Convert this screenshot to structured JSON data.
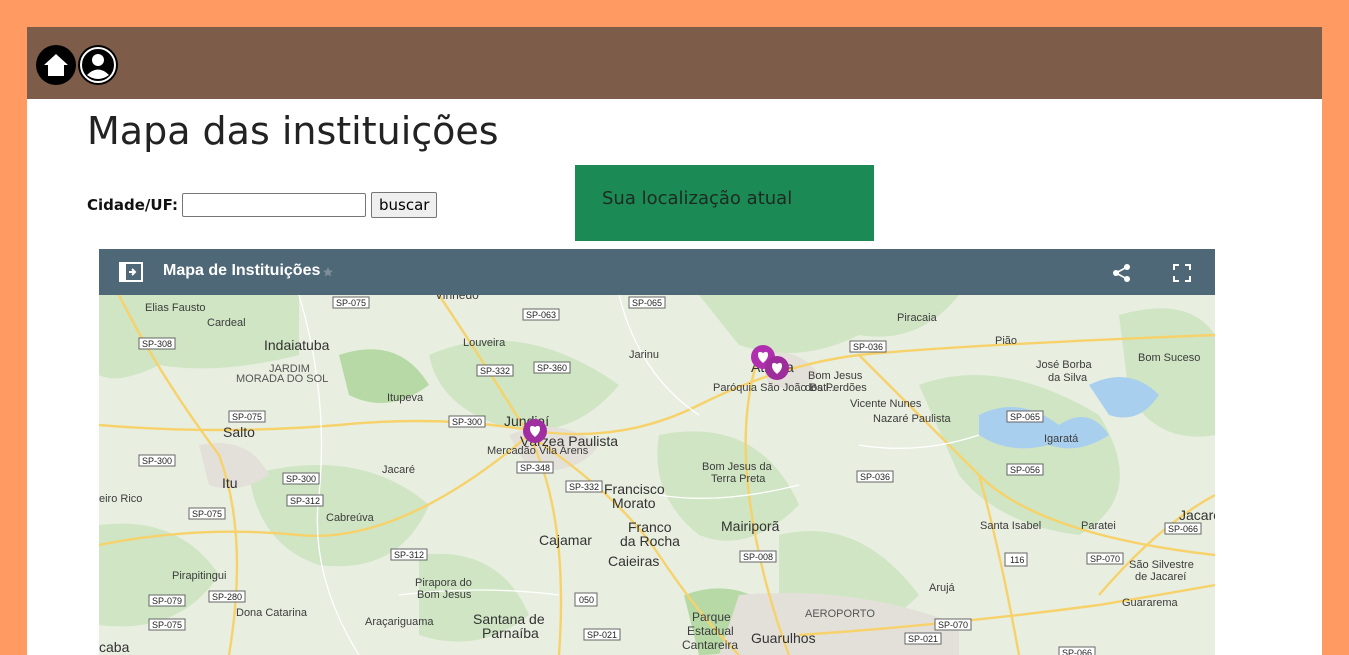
{
  "header": {
    "home_icon": "home-icon",
    "user_icon": "user-icon"
  },
  "page": {
    "title": "Mapa das instituições"
  },
  "search": {
    "label": "Cidade/UF:",
    "value": "",
    "placeholder": "",
    "button_label": "buscar"
  },
  "location_box": {
    "text": "Sua localização atual",
    "color": "#1b8a55"
  },
  "map": {
    "title": "Mapa de Instituições",
    "header_color": "#4f6878",
    "markers": [
      {
        "label": "Paróquia São João Bati..."
      },
      {
        "label": "Mercadão Vila Arens"
      }
    ],
    "places": [
      "Vinhedo",
      "Elias Fausto",
      "Cardeal",
      "Indaiatuba",
      "JARDIM",
      "MORADA DO SOL",
      "Louveira",
      "Jarinu",
      "Atibaia",
      "Piracaia",
      "Pião",
      "José Borba",
      "da Silva",
      "Bom Suceso",
      "Bom Jesus",
      "dos Perdões",
      "Vicente Nunes",
      "Nazaré Paulista",
      "Igaratá",
      "Itupeva",
      "Salto",
      "Jundiaí",
      "Várzea Paulista",
      "Jacareí",
      "Francisco",
      "Morato",
      "Bom Jesus da",
      "Terra Preta",
      "Itu",
      "eiro Rico",
      "Cabreúva",
      "Franco",
      "da Rocha",
      "Mairiporã",
      "Santa Isabel",
      "Paratei",
      "Jacare",
      "Cajamar",
      "Caieiras",
      "Pirapitingui",
      "Pirapora do",
      "Bom Jesus",
      "São Silvestre",
      "de Jacareí",
      "Arujá",
      "Guararema",
      "Dona Catarina",
      "Araçariguama",
      "Santana de",
      "Parnaíba",
      "Parque",
      "Estadual",
      "Cantareira",
      "AEROPORTO",
      "Guarulhos",
      "caba",
      "Jacaré"
    ],
    "shields": [
      "SP-075",
      "SP-065",
      "SP-063",
      "SP-308",
      "SP-036",
      "SP-332",
      "SP-360",
      "SP-300",
      "SP-065",
      "SP-348",
      "SP-056",
      "SP-332",
      "SP-036",
      "SP-312",
      "SP-300",
      "SP-075",
      "SP-312",
      "SP-008",
      "SP-070",
      "SP-066",
      "116",
      "SP-079",
      "SP-280",
      "050",
      "SP-075",
      "SP-021",
      "SP-070",
      "SP-021",
      "SP-066",
      "SP-300",
      "SP-075"
    ]
  }
}
